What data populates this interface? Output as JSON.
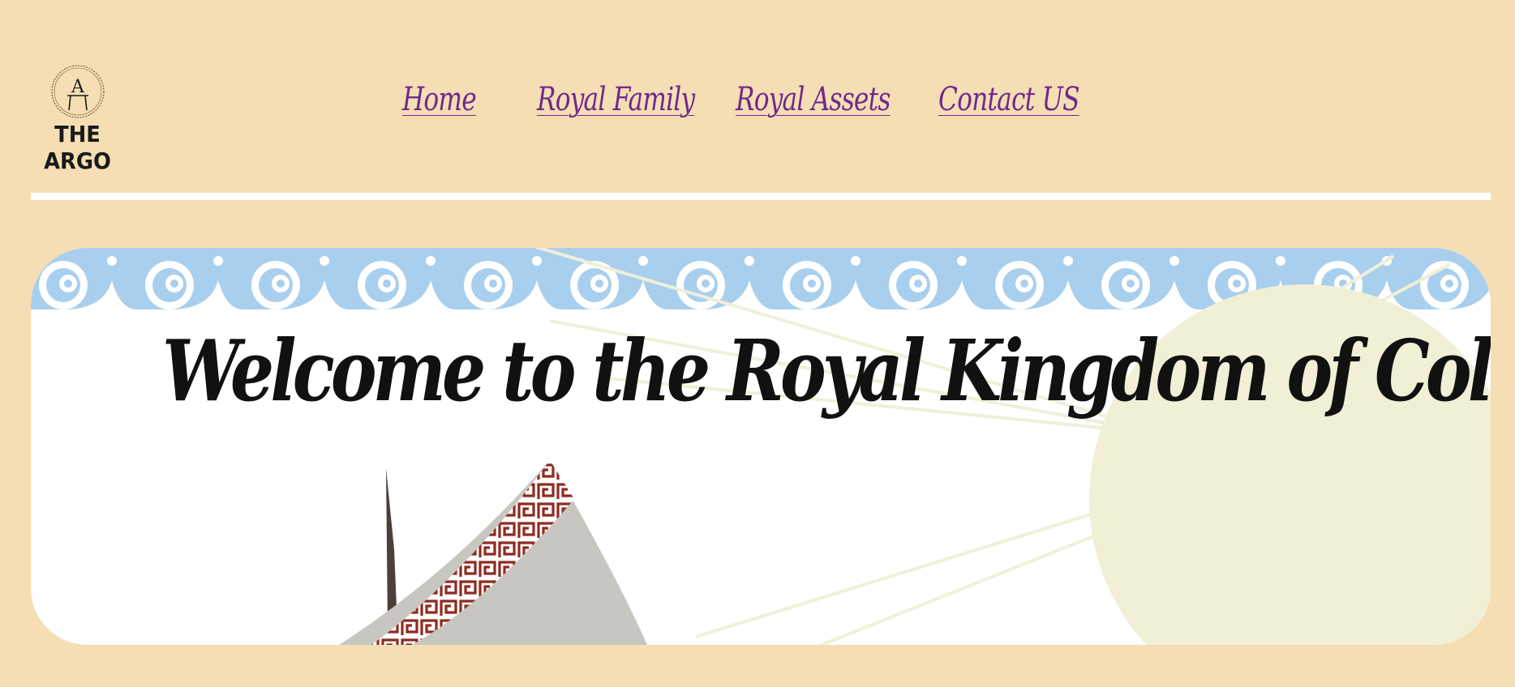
{
  "brand": {
    "name": "THE ARGO",
    "monogram": "A"
  },
  "nav": {
    "items": [
      {
        "label": "Home"
      },
      {
        "label": "Royal Family"
      },
      {
        "label": "Royal Assets"
      },
      {
        "label": "Contact US"
      }
    ]
  },
  "hero": {
    "title": "Welcome to the Royal Kingdom of Colchis"
  },
  "colors": {
    "page_bg": "#f5deb3",
    "nav_link": "#6f2a8c",
    "wave": "#a9cfee",
    "sun": "#f1f0d6",
    "meander": "#8e2b22",
    "sail": "#c8c6c0"
  }
}
